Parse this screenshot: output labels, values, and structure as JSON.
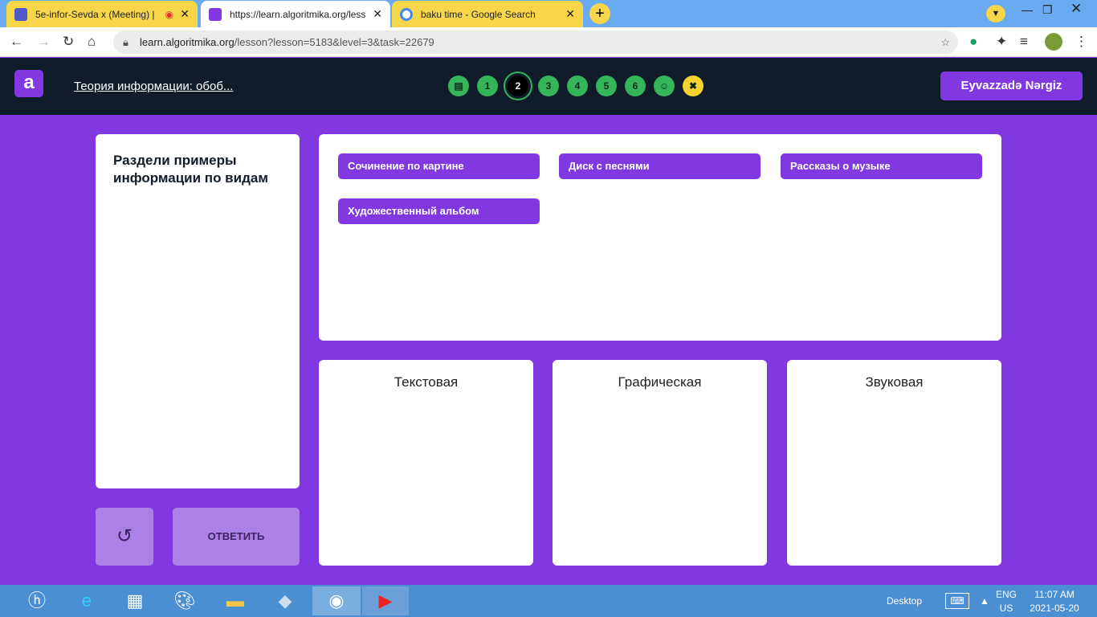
{
  "browser": {
    "tabs": [
      {
        "label": "5e-infor-Sevda x (Meeting) |"
      },
      {
        "label": "https://learn.algoritmika.org/less"
      },
      {
        "label": "baku time - Google Search"
      }
    ],
    "url_domain": "learn.algoritmika.org",
    "url_path": "/lesson?lesson=5183&level=3&task=22679"
  },
  "header": {
    "logo": "a",
    "lesson_title": "Теория информации: обоб...",
    "steps": [
      "1",
      "2",
      "3",
      "4",
      "5",
      "6"
    ],
    "current_step": "2",
    "user": "Eyvazzadə Nərgiz"
  },
  "task": {
    "prompt": "Раздели примеры информации по видам",
    "items": [
      "Сочинение по картине",
      "Диск с песнями",
      "Рассказы о музыке",
      "Художественный альбом"
    ],
    "bins": [
      "Текстовая",
      "Графическая",
      "Звуковая"
    ],
    "reset": "↺",
    "answer": "ОТВЕТИТЬ"
  },
  "taskbar": {
    "desktop": "Desktop",
    "lang1": "ENG",
    "lang2": "US",
    "time": "11:07 AM",
    "date": "2021-05-20"
  }
}
